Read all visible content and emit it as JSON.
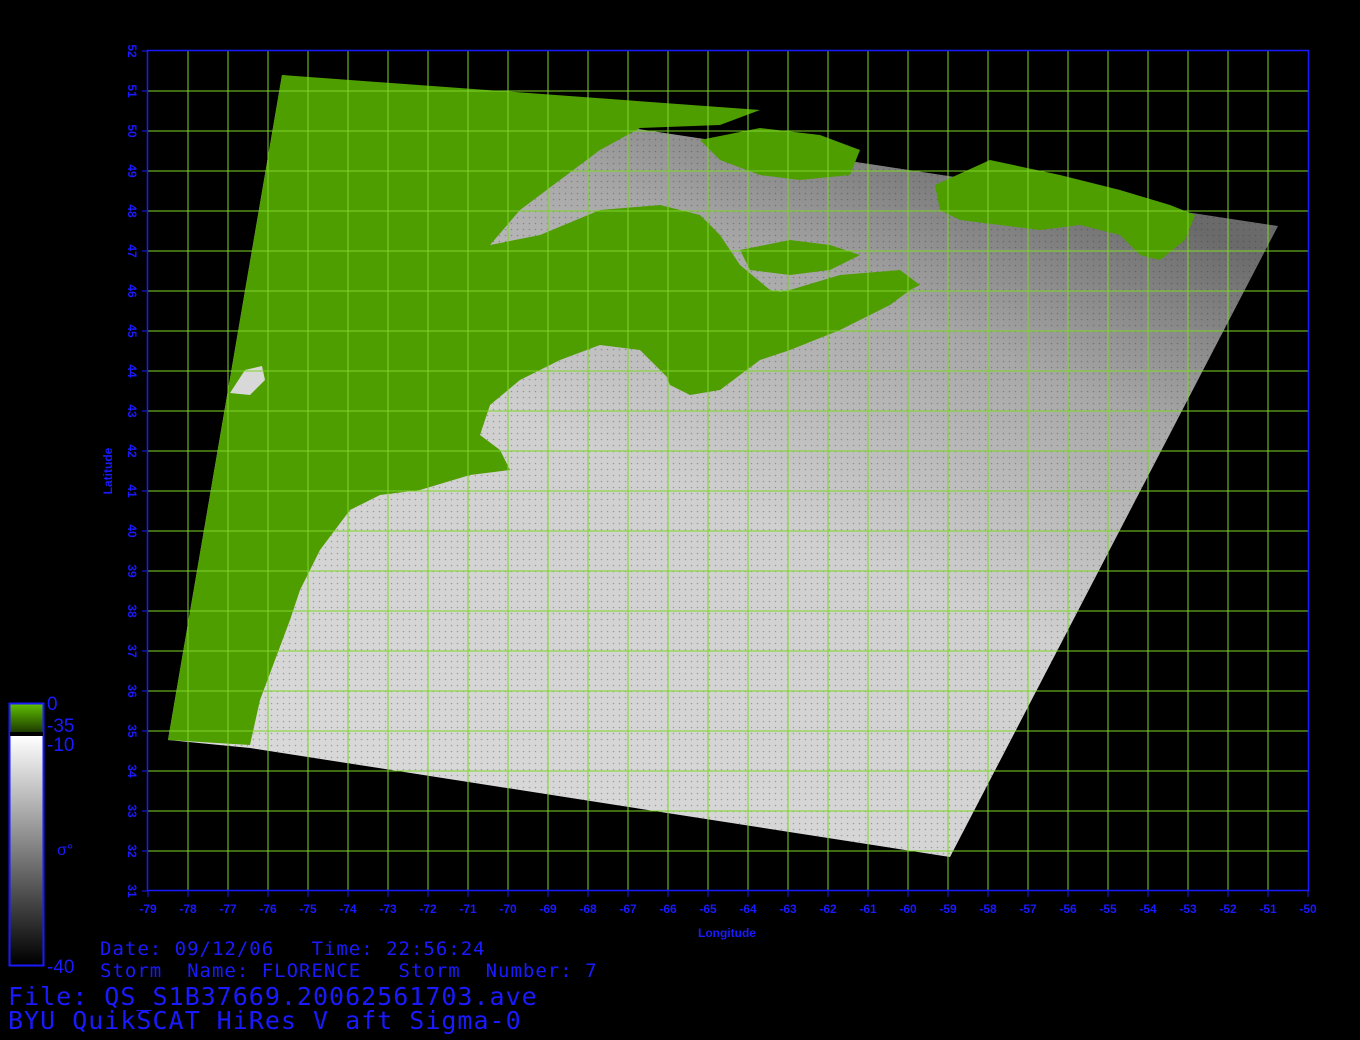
{
  "title": {
    "date_line": "Date: 09/12/06   Time: 22:56:24",
    "storm_line": "Storm  Name: FLORENCE   Storm  Number: 7",
    "file_line": "File: QS_S1B37669.20062561703.ave",
    "product_line": "BYU QuikSCAT HiRes V aft Sigma-0"
  },
  "axes": {
    "x_label": "Longitude",
    "y_label": "Latitude",
    "x_ticks": [
      "-79",
      "-78",
      "-77",
      "-76",
      "-75",
      "-74",
      "-73",
      "-72",
      "-71",
      "-70",
      "-69",
      "-68",
      "-67",
      "-66",
      "-65",
      "-64",
      "-63",
      "-62",
      "-61",
      "-60",
      "-59",
      "-58",
      "-57",
      "-56",
      "-55",
      "-54",
      "-53",
      "-52",
      "-51",
      "-50"
    ],
    "y_ticks": [
      "31",
      "32",
      "33",
      "34",
      "35",
      "36",
      "37",
      "38",
      "39",
      "40",
      "41",
      "42",
      "43",
      "44",
      "45",
      "46",
      "47",
      "48",
      "49",
      "50",
      "51",
      "52"
    ],
    "lon_range": [
      -79,
      -50
    ],
    "lat_range": [
      31,
      52
    ],
    "grid": true
  },
  "colorbar": {
    "land_max": "0",
    "land_min": "-35",
    "ocean_max": "-10",
    "ocean_min": "-40",
    "symbol": "σ°"
  },
  "colors": {
    "background": "#000000",
    "axis": "#1a1aff",
    "grid": "#7fd62a",
    "land": "#4f9e00",
    "ocean_light": "#e8e8e8",
    "ocean_dark": "#5a5a5a"
  }
}
